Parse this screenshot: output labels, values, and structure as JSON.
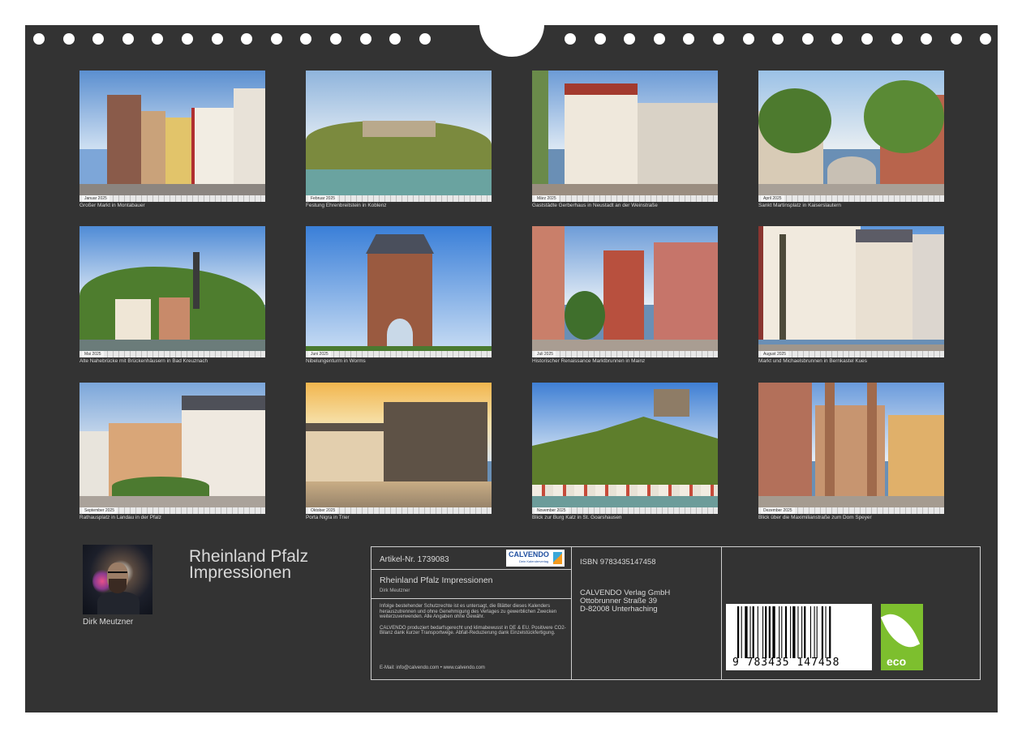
{
  "photos": [
    {
      "caption": "Großer Markt in Montabauer",
      "month": "Januar 2025"
    },
    {
      "caption": "Festung Ehrenbreitstein in Koblenz",
      "month": "Februar 2025"
    },
    {
      "caption": "Gaststädte Gerberhaus in Neustadt an der Weinstraße",
      "month": "März 2025"
    },
    {
      "caption": "Sankt Martinsplatz in Kaiserslautern",
      "month": "April 2025"
    },
    {
      "caption": "Alte Nahebrücke mit Brückenhäusern in Bad Kreuznach",
      "month": "Mai 2025"
    },
    {
      "caption": "Nibelungenturm in Worms",
      "month": "Juni 2025"
    },
    {
      "caption": "Historischer Renaissance Marktbrunnen in Mainz",
      "month": "Juli 2025"
    },
    {
      "caption": "Markt und Michaelsbrunnen in Bernkastel Kues",
      "month": "August 2025"
    },
    {
      "caption": "Rathausplatz in Landau in der Pfalz",
      "month": "September 2025"
    },
    {
      "caption": "Porta Nigra in Trier",
      "month": "Oktober 2025"
    },
    {
      "caption": "Blick zur Burg Katz in St. Goarshausen",
      "month": "November 2025"
    },
    {
      "caption": "Blick über die Maximilianstraße zum Dom Speyer",
      "month": "Dezember 2025"
    }
  ],
  "author": {
    "name": "Dirk Meutzner"
  },
  "calendar_title": "Rheinland Pfalz Impressionen",
  "info": {
    "artikel": "Artikel-Nr. 1739083",
    "logo_text": "CALVENDO",
    "logo_sub": "Dein Kalenderverlag",
    "product_title": "Rheinland Pfalz Impressionen",
    "product_author": "Dirk Meutzner",
    "legal_1": "Infolge bestehender Schutzrechte ist es untersagt, die Blätter dieses Kalenders herauszutrennen und ohne Genehmigung des Verlages zu gewerblichen Zwecken weiterzuverwenden. Alle Angaben ohne Gewähr.",
    "legal_2": "CALVENDO produziert bedarfsgerecht und klimabewusst in DE & EU. Positivere CO2-Bilanz dank kurzer Transportwege. Abfall-Reduzierung dank Einzelstückfertigung.",
    "email": "E-Mail: info@calvendo.com • www.calvendo.com",
    "isbn": "ISBN 9783435147458",
    "publisher_1": "CALVENDO Verlag GmbH",
    "publisher_2": "Ottobrunner Straße 39",
    "publisher_3": "D-82008 Unterhaching",
    "barcode_number": "9 783435 147458",
    "eco_label": "eco"
  }
}
